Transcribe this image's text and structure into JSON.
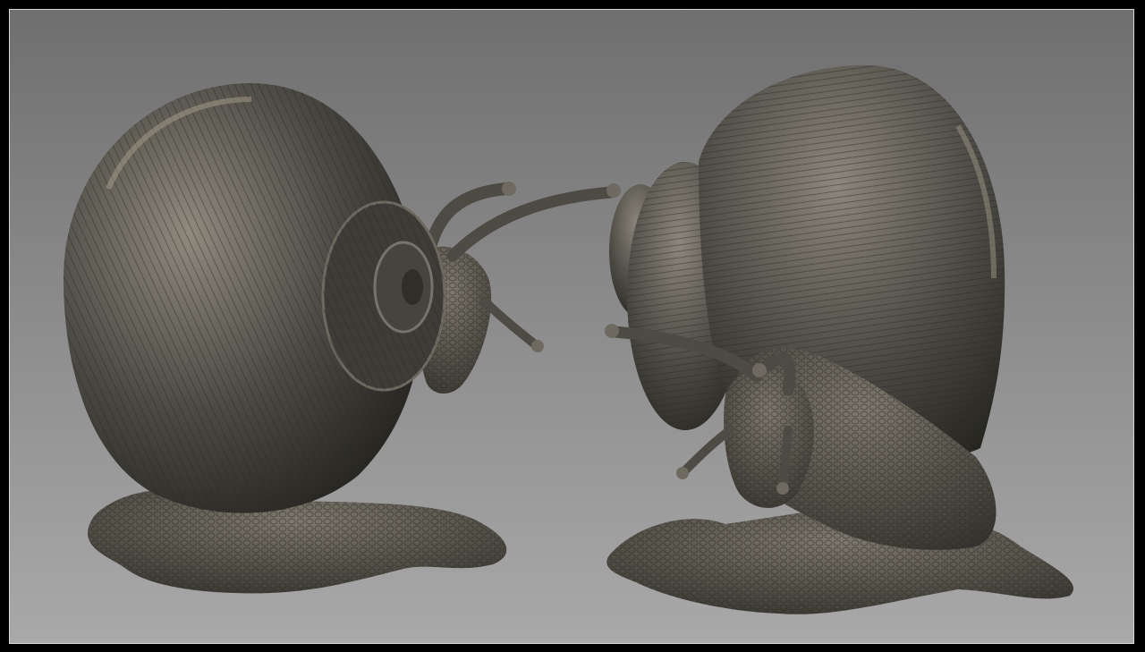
{
  "scene": {
    "subject": "snail-sculpt",
    "views": [
      "back-three-quarter",
      "front-three-quarter"
    ],
    "colors": {
      "background_top": "#6f6f6f",
      "background_bottom": "#a9a9a9",
      "frame": "#000000",
      "frame_border": "#d8d8d8",
      "material_dark": "#2f2e2b",
      "material_mid": "#5e5b53",
      "material_light": "#b7ad98"
    }
  }
}
